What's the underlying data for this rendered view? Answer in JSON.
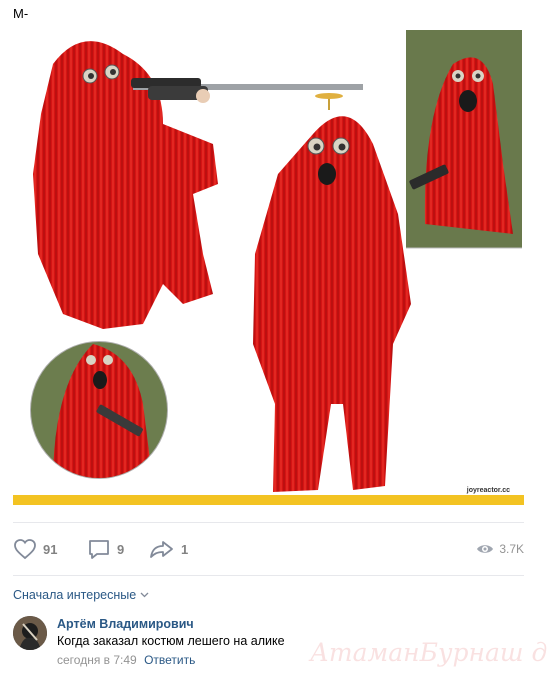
{
  "post": {
    "text": "М-"
  },
  "image": {
    "subject": "red-ghillie-suit-photo-collage",
    "source_watermark": "joyreactor.cc",
    "accent_red": "#d41414",
    "bar_color": "#f3c322"
  },
  "actions": {
    "likes": "91",
    "comments": "9",
    "shares": "1",
    "views": "3.7K"
  },
  "comments_section": {
    "sort_label": "Сначала интересные",
    "items": [
      {
        "author": "Артём Владимирович",
        "text": "Когда заказал костюм лешего на алике",
        "time": "сегодня в 7:49",
        "reply_label": "Ответить"
      }
    ]
  },
  "watermark": {
    "text": "АтаманБурнаш для ЯП"
  }
}
